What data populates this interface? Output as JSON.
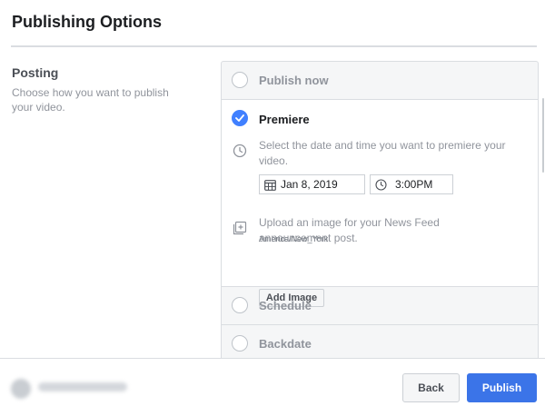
{
  "header": {
    "title": "Publishing Options"
  },
  "posting": {
    "label": "Posting",
    "description": "Choose how you want to publish your video."
  },
  "options": [
    {
      "label": "Publish now",
      "selected": false
    },
    {
      "label": "Premiere",
      "selected": true
    },
    {
      "label": "Schedule",
      "selected": false
    },
    {
      "label": "Backdate",
      "selected": false
    }
  ],
  "premiere": {
    "datetime_help": "Select the date and time you want to premiere your video.",
    "date_value": "Jan 8, 2019",
    "time_value": "3:00PM",
    "timezone": "America/New_York",
    "image_help": "Upload an image for your News Feed announcement post.",
    "add_image_label": "Add Image"
  },
  "footer": {
    "back_label": "Back",
    "publish_label": "Publish"
  },
  "colors": {
    "accent": "#3b74e8",
    "radio_checked": "#4080ff",
    "border": "#dadde1",
    "muted_text": "#90949c"
  },
  "icons": {
    "checked_radio": "check-icon",
    "time": "clock-icon",
    "date": "calendar-icon",
    "image": "add-image-icon"
  }
}
